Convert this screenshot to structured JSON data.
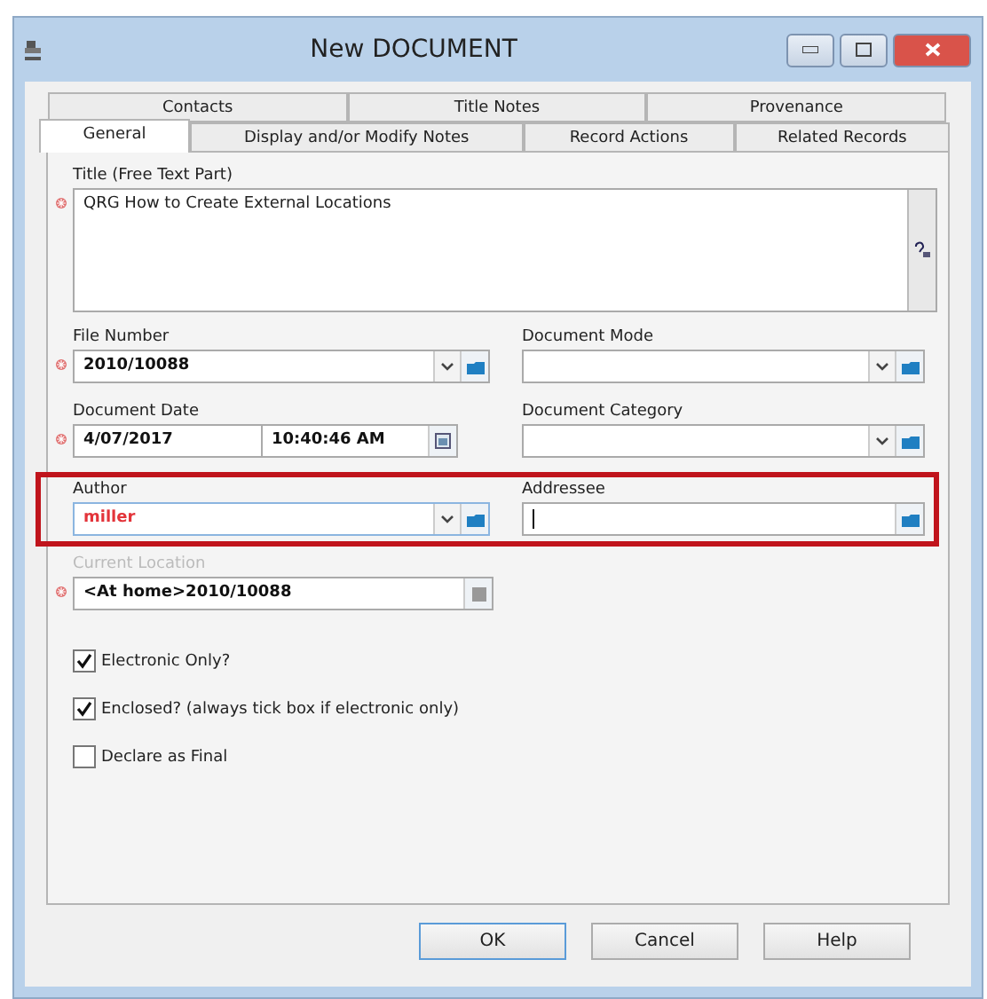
{
  "window": {
    "title": "New DOCUMENT"
  },
  "tabs_back": [
    {
      "label": "Contacts",
      "selected": false
    },
    {
      "label": "Title Notes",
      "selected": false
    },
    {
      "label": "Provenance",
      "selected": false
    }
  ],
  "tabs_front": [
    {
      "label": "General",
      "selected": true
    },
    {
      "label": "Display and/or Modify Notes",
      "selected": false
    },
    {
      "label": "Record Actions",
      "selected": false
    },
    {
      "label": "Related Records",
      "selected": false
    }
  ],
  "title_field": {
    "label": "Title (Free Text Part)",
    "value": "QRG How to Create External Locations",
    "required": true
  },
  "field_rows": [
    {
      "highlighted": false,
      "fields": [
        {
          "kind": "combo",
          "label": "File Number",
          "value": "2010/10088",
          "required": true,
          "error": false,
          "focused": false
        },
        {
          "kind": "combo",
          "label": "Document Mode",
          "required": false,
          "error": false,
          "focused": false
        }
      ]
    },
    {
      "highlighted": false,
      "fields": [
        {
          "kind": "datetime",
          "label": "Document Date",
          "date": "4/07/2017",
          "time": "10:40:46 AM",
          "required": true
        },
        {
          "kind": "combo",
          "label": "Document Category",
          "required": false,
          "error": false,
          "focused": false
        }
      ]
    },
    {
      "highlighted": true,
      "fields": [
        {
          "kind": "combo",
          "label": "Author",
          "value": "miller",
          "required": false,
          "error": true,
          "focused": false
        },
        {
          "kind": "lookup",
          "label": "Addressee",
          "required": false,
          "error": false,
          "focused": true
        }
      ]
    },
    {
      "highlighted": false,
      "fields": [
        {
          "kind": "location",
          "label": "Current Location",
          "value": "<At home>2010/10088",
          "required": true
        }
      ]
    }
  ],
  "checkboxes": [
    {
      "label": "Electronic Only?",
      "checked": true
    },
    {
      "label": "Enclosed? (always tick box if electronic only)",
      "checked": true
    },
    {
      "label": "Declare as Final",
      "checked": false
    }
  ],
  "buttons": [
    {
      "label": "OK",
      "default": true
    },
    {
      "label": "Cancel",
      "default": false
    },
    {
      "label": "Help",
      "default": false
    }
  ]
}
